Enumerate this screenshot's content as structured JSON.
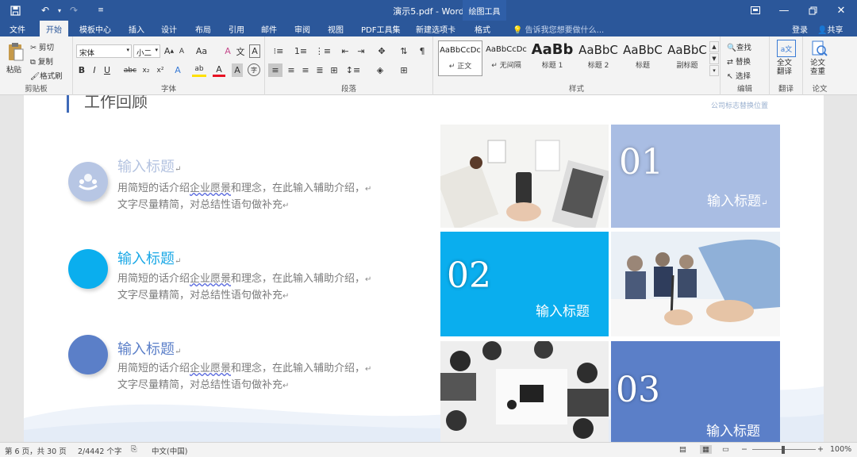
{
  "window": {
    "title": "演示5.pdf - Word",
    "context_tab": "绘图工具",
    "icons": {
      "save": "save-icon",
      "undo": "undo-icon",
      "redo": "redo-icon",
      "customize": "customize-icon"
    }
  },
  "tabs": [
    {
      "label": "文件"
    },
    {
      "label": "开始"
    },
    {
      "label": "模板中心"
    },
    {
      "label": "插入"
    },
    {
      "label": "设计"
    },
    {
      "label": "布局"
    },
    {
      "label": "引用"
    },
    {
      "label": "邮件"
    },
    {
      "label": "审阅"
    },
    {
      "label": "视图"
    },
    {
      "label": "PDF工具集"
    },
    {
      "label": "新建选项卡"
    },
    {
      "label": "格式"
    }
  ],
  "tell_me": "告诉我您想要做什么...",
  "account": {
    "login": "登录",
    "share": "共享"
  },
  "ribbon": {
    "clipboard": {
      "paste": "粘贴",
      "cut": "剪切",
      "copy": "复制",
      "format_painter": "格式刷",
      "label": "剪贴板"
    },
    "font": {
      "name": "宋体",
      "size": "小二",
      "label": "字体",
      "grow": "A",
      "shrink": "A",
      "case": "Aa",
      "clear": "A",
      "char_border": "A",
      "bold": "B",
      "italic": "I",
      "underline": "U",
      "strike": "abc",
      "subscript": "x₂",
      "superscript": "x²",
      "text_effect": "A",
      "highlight": "ab",
      "font_color": "A",
      "char_shading": "A",
      "enclose": "字"
    },
    "paragraph": {
      "label": "段落"
    },
    "styles": {
      "label": "样式",
      "items": [
        {
          "sample": "AaBbCcDc",
          "name": "正文"
        },
        {
          "sample": "AaBbCcDc",
          "name": "无间隔"
        },
        {
          "sample": "AaBb",
          "name": "标题 1"
        },
        {
          "sample": "AaBbC",
          "name": "标题 2"
        },
        {
          "sample": "AaBbC",
          "name": "标题"
        },
        {
          "sample": "AaBbC",
          "name": "副标题"
        }
      ]
    },
    "editing": {
      "find": "查找",
      "replace": "替换",
      "select": "选择",
      "label": "编辑"
    },
    "translate": {
      "button": "全文\n翻译",
      "label": "翻译"
    },
    "paper": {
      "button": "论文\n查重",
      "label": "论文"
    }
  },
  "slide": {
    "title": "工作回顾",
    "logo_placeholder": "公司标志替换位置",
    "items": [
      {
        "title": "输入标题",
        "desc_pre": "用简短的话介绍",
        "desc_ul": "企业愿景",
        "desc_mid": "和理念，在此输入辅助介绍，",
        "desc_line2": "文字尽量精简，对总结性语句做补充",
        "color": "#b7c6e4",
        "title_color": "#b4c3e0"
      },
      {
        "title": "输入标题",
        "desc_pre": "用简短的话介绍",
        "desc_ul": "企业愿景",
        "desc_mid": "和理念，在此输入辅助介绍，",
        "desc_line2": "文字尽量精简，对总结性语句做补充",
        "color": "#0aaeee",
        "title_color": "#1aa8e6"
      },
      {
        "title": "输入标题",
        "desc_pre": "用简短的话介绍",
        "desc_ul": "企业愿景",
        "desc_mid": "和理念，在此输入辅助介绍，",
        "desc_line2": "文字尽量精简，对总结性语句做补充",
        "color": "#5b7fc8",
        "title_color": "#5b7fc8"
      }
    ],
    "tiles": [
      {
        "num": "01",
        "label": "输入标题",
        "color": "#a9bde3"
      },
      {
        "num": "02",
        "label": "输入标题",
        "color": "#0aaeee"
      },
      {
        "num": "03",
        "label": "输入标题",
        "color": "#5b7fc8"
      }
    ]
  },
  "status": {
    "page": "第 6 页，共 30 页",
    "words": "2/4442 个字",
    "language": "中文(中国)",
    "zoom": "100%"
  }
}
